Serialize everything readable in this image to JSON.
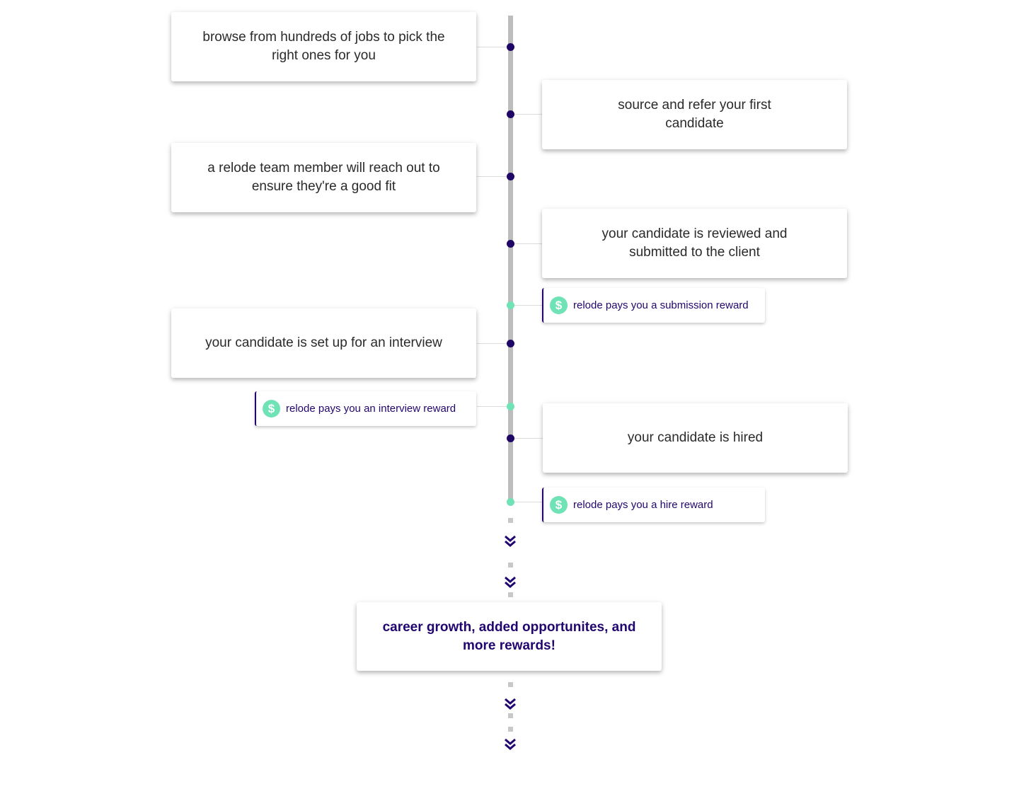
{
  "steps": [
    {
      "text": "browse from hundreds of jobs to pick the right ones for you",
      "side": "left"
    },
    {
      "text": "source and refer your first candidate",
      "side": "right"
    },
    {
      "text": "a relode team member will reach out to ensure they're a good fit",
      "side": "left"
    },
    {
      "text": "your candidate is reviewed and submitted to the client",
      "side": "right"
    },
    {
      "text": "your candidate is set up for an interview",
      "side": "left"
    },
    {
      "text": "your candidate is hired",
      "side": "right"
    }
  ],
  "rewards": [
    {
      "text": "relode pays you a submission reward",
      "icon": "dollar-coin-icon",
      "symbol": "$"
    },
    {
      "text": "relode pays you an interview reward",
      "icon": "dollar-coin-icon",
      "symbol": "$"
    },
    {
      "text": "relode pays you a hire reward",
      "icon": "dollar-coin-icon",
      "symbol": "$"
    }
  ],
  "final": {
    "text": "career growth, added opportunites, and more rewards!"
  },
  "colors": {
    "accent": "#22066f",
    "step_dot": "#1f0565",
    "reward_green": "#6fe3b5",
    "rail": "#bdbdbd",
    "text": "#2a2a2a"
  }
}
